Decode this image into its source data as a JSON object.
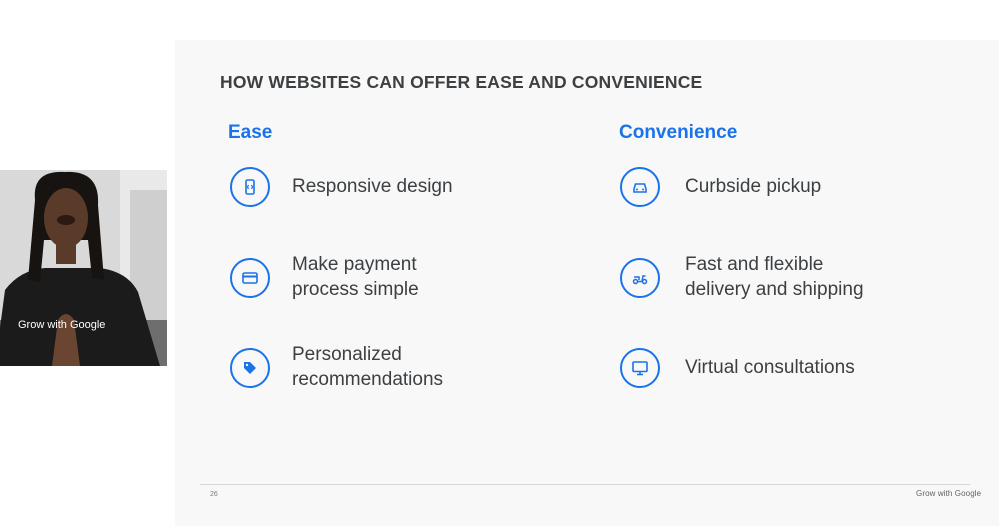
{
  "slide": {
    "title": "HOW WEBSITES CAN OFFER EASE AND CONVENIENCE",
    "accent_color": "#1a73e8",
    "ease": {
      "heading": "Ease",
      "items": [
        {
          "icon": "responsive-phone-icon",
          "lines": [
            "Responsive design"
          ]
        },
        {
          "icon": "credit-card-icon",
          "lines": [
            "Make payment",
            "process simple"
          ]
        },
        {
          "icon": "tag-icon",
          "lines": [
            "Personalized",
            "recommendations"
          ]
        }
      ]
    },
    "convenience": {
      "heading": "Convenience",
      "items": [
        {
          "icon": "car-icon",
          "lines": [
            "Curbside pickup"
          ]
        },
        {
          "icon": "scooter-icon",
          "lines": [
            "Fast and flexible",
            "delivery and shipping"
          ]
        },
        {
          "icon": "monitor-icon",
          "lines": [
            "Virtual consultations"
          ]
        }
      ]
    },
    "page_number": "26",
    "brand": "Grow with Google"
  },
  "presenter": {
    "shirt_text": "Grow with Google"
  }
}
